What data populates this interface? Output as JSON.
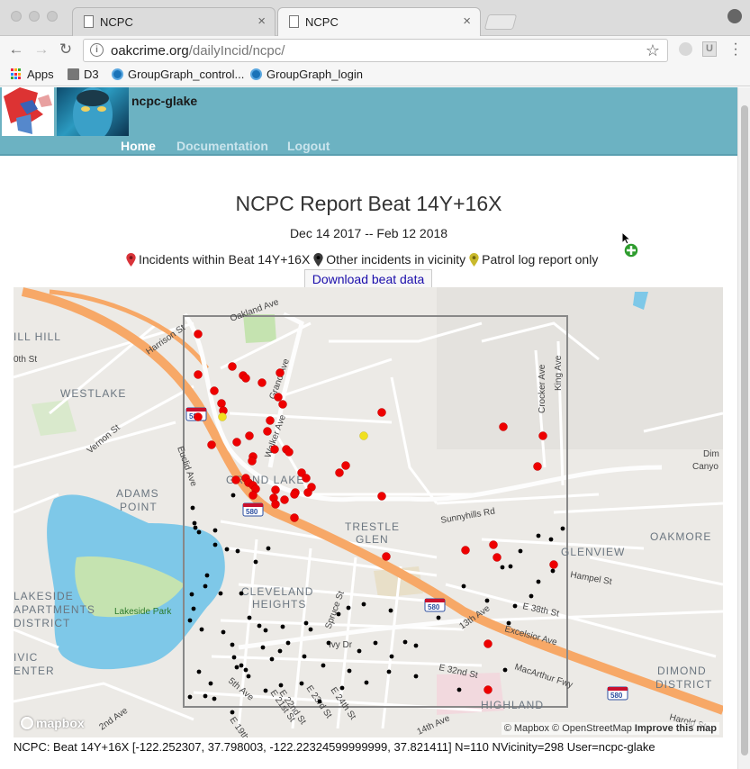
{
  "browser": {
    "tabs": [
      {
        "label": "NCPC",
        "active": false
      },
      {
        "label": "NCPC",
        "active": true
      }
    ],
    "url_host": "oakcrime.org",
    "url_path": "/dailyIncid/ncpc/",
    "extension_label": "U",
    "bookmarks": [
      {
        "label": "Apps",
        "icon": "apps-grid-icon"
      },
      {
        "label": "D3",
        "icon": "folder-icon"
      },
      {
        "label": "GroupGraph_control...",
        "icon": "globe-icon"
      },
      {
        "label": "GroupGraph_login",
        "icon": "globe-icon"
      }
    ]
  },
  "site": {
    "user_label": "ncpc-glake",
    "nav": [
      {
        "label": "Home",
        "active": true
      },
      {
        "label": "Documentation",
        "active": false
      },
      {
        "label": "Logout",
        "active": false
      }
    ],
    "header_color": "#6cb2c2"
  },
  "report": {
    "title": "NCPC Report Beat 14Y+16X",
    "date_range": "Dec 14 2017 -- Feb 12 2018",
    "legend": [
      {
        "label": "Incidents within Beat 14Y+16X",
        "color": "#d9343a"
      },
      {
        "label": "Other incidents in vicinity",
        "color": "#3a3a3a"
      },
      {
        "label": "Patrol log report only",
        "color": "#c9b92c"
      }
    ],
    "download_label": "Download beat data",
    "footer": "NCPC: Beat 14Y+16X [-122.252307, 37.798003, -122.22324599999999, 37.821411] N=110 NVicinity=298 User=ncpc-glake"
  },
  "map": {
    "attribution_prefix": "© Mapbox © OpenStreetMap",
    "attribution_link": "Improve this map",
    "logo_text": "mapbox",
    "colors": {
      "incident_in_beat": "#ee0000",
      "vicinity": "#000000",
      "patrol": "#f0e020",
      "freeway": "#f7a867",
      "water": "#7ec8e8",
      "park": "#c5e3b0"
    },
    "area_labels": [
      "WESTLAKE",
      "ADAMS",
      "POINT",
      "GRAND LAKE",
      "TRESTLE",
      "GLEN",
      "GLENVIEW",
      "OAKMORE",
      "CLEVELAND",
      "HEIGHTS",
      "LAKESIDE",
      "APARTMENTS",
      "DISTRICT",
      "DIMOND",
      "DISTRICT",
      "HIGHLAND",
      "PARK",
      "ILL HILL",
      "IVIC",
      "ENTER"
    ],
    "street_labels": [
      "Oakland Ave",
      "Harrison St",
      "Grand Ave",
      "Walker Ave",
      "Vernon St",
      "Euclid Ave",
      "Crocker Ave",
      "King Ave",
      "Sunnyhills Rd",
      "Hampel St",
      "E 38th St",
      "13th Ave",
      "Excelsior Ave",
      "MacArthur Fwy",
      "E 32nd St",
      "Spruce St",
      "Ivy Dr",
      "5th Ave",
      "E 22nd St",
      "E 23rd St",
      "E 24th St",
      "E 21st St",
      "E 19th",
      "2nd Ave",
      "14th Ave",
      "Harold St",
      "0th St",
      "Dim",
      "Canyo"
    ],
    "park_label": "Lakeside Park",
    "shields": [
      "580",
      "580",
      "580",
      "580"
    ]
  }
}
